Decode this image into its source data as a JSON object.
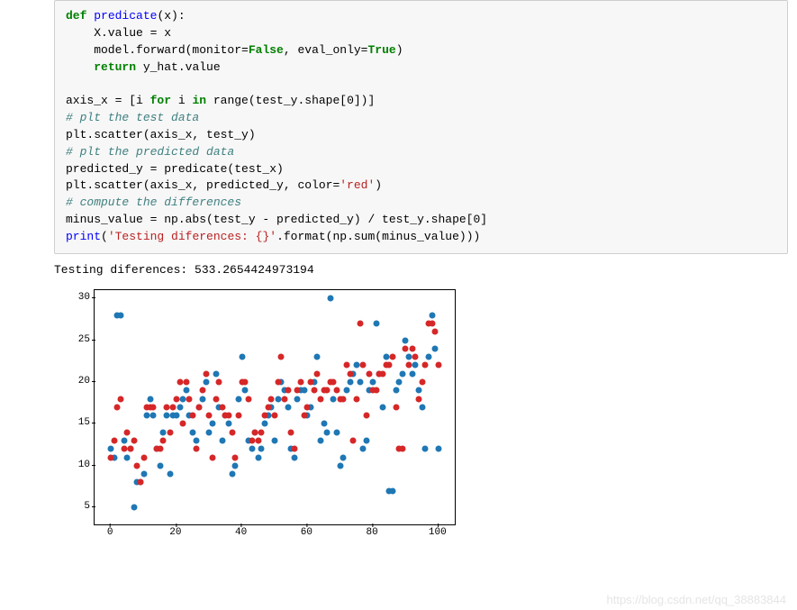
{
  "code": {
    "tok": {
      "def": "def",
      "for": "for",
      "in": "in",
      "return": "return",
      "false": "False",
      "true": "True",
      "print": "print",
      "fn_predicate": "predicate",
      "cm_test": "# plt the test data",
      "cm_pred": "# plt the predicted data",
      "cm_diff": "# compute the differences",
      "str_red": "'red'",
      "str_fmt": "'Testing diferences: {}'"
    },
    "line1a": "(x):",
    "line2": "    X.value = x",
    "line3a": "    model.forward(monitor=",
    "line3b": ", eval_only=",
    "line3c": ")",
    "line4a": "    ",
    "line4b": " y_hat.value",
    "blank": "",
    "line5a": "axis_x = [i ",
    "line5b": " i ",
    "line5c": " range(test_y.shape[0])]",
    "line7": "plt.scatter(axis_x, test_y)",
    "line9": "predicted_y = predicate(test_x)",
    "line10a": "plt.scatter(axis_x, predicted_y, color=",
    "line10b": ")",
    "line12": "minus_value = np.abs(test_y - predicted_y) / test_y.shape[0]",
    "line13a": "(",
    "line13b": ".format(np.sum(minus_value)))"
  },
  "output_text": "Testing diferences: 533.2654424973194",
  "watermark": "https://blog.csdn.net/qq_38883844",
  "chart_data": {
    "type": "scatter",
    "xlabel": "",
    "ylabel": "",
    "xlim": [
      -5,
      105
    ],
    "ylim": [
      3,
      31
    ],
    "xticks": [
      0,
      20,
      40,
      60,
      80,
      100
    ],
    "yticks": [
      5,
      10,
      15,
      20,
      25,
      30
    ],
    "series": [
      {
        "name": "test_y",
        "color": "#1f77b4",
        "x": [
          0,
          1,
          2,
          3,
          4,
          5,
          6,
          7,
          8,
          9,
          10,
          11,
          12,
          13,
          14,
          15,
          16,
          17,
          18,
          19,
          20,
          21,
          22,
          23,
          24,
          25,
          26,
          27,
          28,
          29,
          30,
          31,
          32,
          33,
          34,
          35,
          36,
          37,
          38,
          39,
          40,
          41,
          42,
          43,
          44,
          45,
          46,
          47,
          48,
          49,
          50,
          51,
          52,
          53,
          54,
          55,
          56,
          57,
          58,
          59,
          60,
          61,
          62,
          63,
          64,
          65,
          66,
          67,
          68,
          69,
          70,
          71,
          72,
          73,
          74,
          75,
          76,
          77,
          78,
          79,
          80,
          81,
          82,
          83,
          84,
          85,
          86,
          87,
          88,
          89,
          90,
          91,
          92,
          93,
          94,
          95,
          96,
          97,
          98,
          99,
          100
        ],
        "y": [
          12,
          11,
          28,
          28,
          13,
          11,
          12,
          5,
          8,
          8,
          9,
          16,
          18,
          16,
          12,
          10,
          14,
          16,
          9,
          16,
          16,
          17,
          18,
          19,
          16,
          14,
          13,
          17,
          18,
          20,
          14,
          15,
          21,
          17,
          13,
          16,
          15,
          9,
          10,
          18,
          23,
          19,
          13,
          12,
          14,
          11,
          12,
          15,
          16,
          17,
          13,
          18,
          20,
          19,
          17,
          12,
          11,
          18,
          19,
          19,
          16,
          17,
          20,
          23,
          13,
          15,
          14,
          30,
          18,
          14,
          10,
          11,
          19,
          20,
          21,
          22,
          20,
          12,
          13,
          19,
          20,
          27,
          21,
          17,
          23,
          7,
          7,
          19,
          20,
          21,
          25,
          23,
          21,
          22,
          19,
          17,
          12,
          23,
          28,
          24,
          12
        ]
      },
      {
        "name": "predicted_y",
        "color": "#d62728",
        "x": [
          0,
          1,
          2,
          3,
          4,
          5,
          6,
          7,
          8,
          9,
          10,
          11,
          12,
          13,
          14,
          15,
          16,
          17,
          18,
          19,
          20,
          21,
          22,
          23,
          24,
          25,
          26,
          27,
          28,
          29,
          30,
          31,
          32,
          33,
          34,
          35,
          36,
          37,
          38,
          39,
          40,
          41,
          42,
          43,
          44,
          45,
          46,
          47,
          48,
          49,
          50,
          51,
          52,
          53,
          54,
          55,
          56,
          57,
          58,
          59,
          60,
          61,
          62,
          63,
          64,
          65,
          66,
          67,
          68,
          69,
          70,
          71,
          72,
          73,
          74,
          75,
          76,
          77,
          78,
          79,
          80,
          81,
          82,
          83,
          84,
          85,
          86,
          87,
          88,
          89,
          90,
          91,
          92,
          93,
          94,
          95,
          96,
          97,
          98,
          99,
          100
        ],
        "y": [
          11,
          13,
          17,
          18,
          12,
          14,
          12,
          13,
          10,
          8,
          11,
          17,
          17,
          17,
          12,
          12,
          13,
          17,
          14,
          17,
          18,
          20,
          15,
          20,
          18,
          16,
          12,
          17,
          19,
          21,
          16,
          11,
          18,
          20,
          17,
          16,
          16,
          14,
          11,
          16,
          20,
          20,
          18,
          13,
          14,
          13,
          14,
          16,
          17,
          18,
          16,
          20,
          23,
          18,
          19,
          14,
          12,
          19,
          20,
          16,
          17,
          20,
          19,
          21,
          18,
          19,
          19,
          20,
          20,
          19,
          18,
          18,
          22,
          21,
          13,
          18,
          27,
          22,
          16,
          21,
          19,
          19,
          21,
          21,
          22,
          22,
          23,
          17,
          12,
          12,
          24,
          22,
          24,
          23,
          18,
          20,
          22,
          27,
          27,
          26,
          22
        ]
      }
    ]
  }
}
